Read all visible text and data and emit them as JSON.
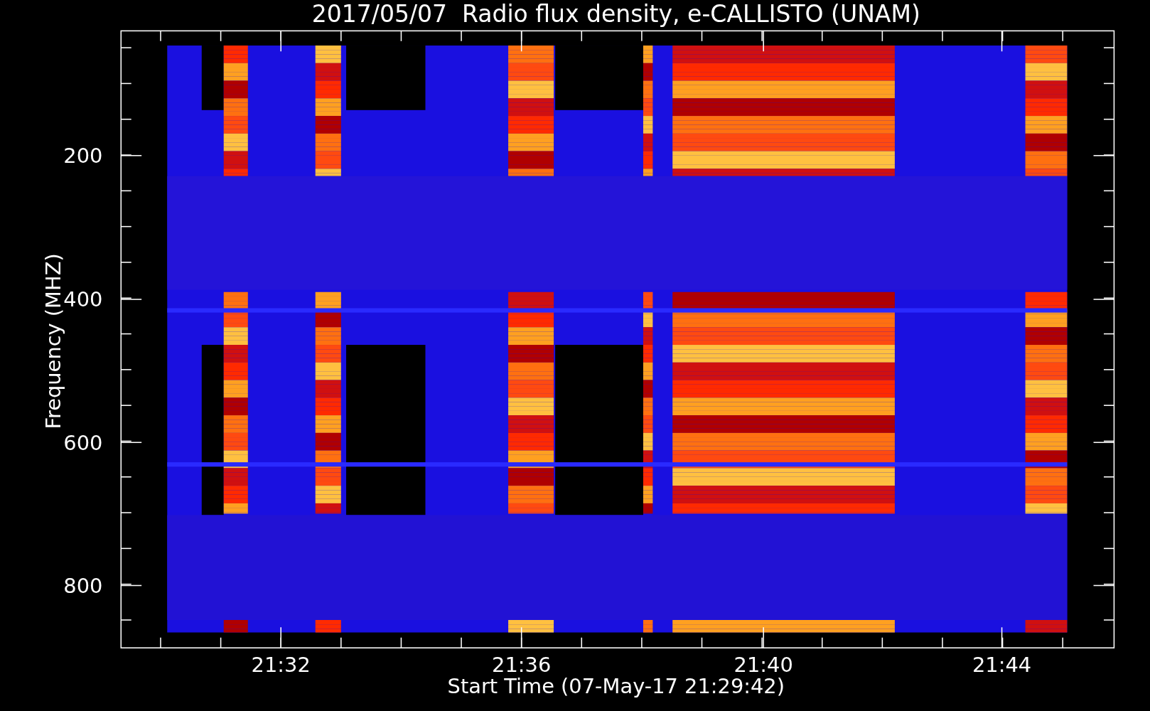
{
  "title": "2017/05/07  Radio flux density, e-CALLISTO (UNAM)",
  "ylabel": "Frequency (MHZ)",
  "xlabel": "Start Time (07-May-17 21:29:42)",
  "yticks": [
    "200",
    "400",
    "600",
    "800"
  ],
  "xticks": [
    "21:32",
    "21:36",
    "21:40",
    "21:44"
  ]
}
